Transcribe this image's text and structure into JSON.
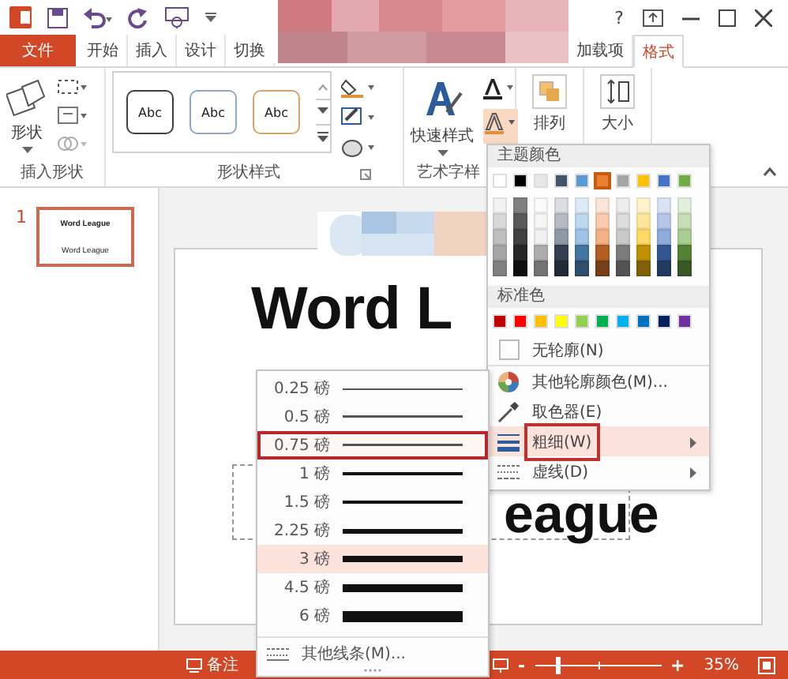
{
  "window": {
    "help": "?"
  },
  "tabs": [
    {
      "label": "文件",
      "kind": "file",
      "selected": false
    },
    {
      "label": "开始",
      "kind": "tab",
      "selected": false
    },
    {
      "label": "插入",
      "kind": "tab",
      "selected": false
    },
    {
      "label": "设计",
      "kind": "tab",
      "selected": false
    },
    {
      "label": "切换",
      "kind": "tab",
      "selected": false
    },
    {
      "label": "加载项",
      "kind": "tab",
      "selected": false
    },
    {
      "label": "格式",
      "kind": "tab",
      "selected": true
    }
  ],
  "ribbon": {
    "insert_shapes": {
      "label": "插入形状",
      "button": "形状"
    },
    "shape_styles": {
      "label": "形状样式",
      "styles": [
        {
          "text": "Abc",
          "color": "#404040"
        },
        {
          "text": "Abc",
          "color": "#8fa9c4"
        },
        {
          "text": "Abc",
          "color": "#d9a46a"
        }
      ]
    },
    "wordart_styles": {
      "label": "艺术字样",
      "button": "快速样式"
    },
    "arrange": {
      "button": "排列"
    },
    "size": {
      "button": "大小"
    }
  },
  "thumbnails": [
    {
      "number": "1",
      "lines": [
        "Word League",
        "Word League"
      ],
      "selected": true
    }
  ],
  "slide": {
    "title": "Word L",
    "subtitle": "eague"
  },
  "outline_menu": {
    "theme_header": "主题颜色",
    "theme_colors": [
      {
        "color": "#ffffff",
        "selected": false
      },
      {
        "color": "#000000",
        "selected": false
      },
      {
        "color": "#e7e6e6",
        "selected": false
      },
      {
        "color": "#44546a",
        "selected": false
      },
      {
        "color": "#5b9bd5",
        "selected": false
      },
      {
        "color": "#ed7d31",
        "selected": true
      },
      {
        "color": "#a5a5a5",
        "selected": false
      },
      {
        "color": "#ffc000",
        "selected": false
      },
      {
        "color": "#4472c4",
        "selected": false
      },
      {
        "color": "#70ad47",
        "selected": false
      }
    ],
    "standard_header": "标准色",
    "standard_colors": [
      {
        "color": "#c00000"
      },
      {
        "color": "#ff0000"
      },
      {
        "color": "#ffc000"
      },
      {
        "color": "#ffff00"
      },
      {
        "color": "#92d050"
      },
      {
        "color": "#00b050"
      },
      {
        "color": "#00b0f0"
      },
      {
        "color": "#0070c0"
      },
      {
        "color": "#002060"
      },
      {
        "color": "#7030a0"
      }
    ],
    "items": [
      {
        "label": "无轮廓(N)",
        "kind": "none",
        "submenu": false,
        "highlighted": false
      },
      {
        "label": "其他轮廓颜色(M)...",
        "kind": "palette",
        "submenu": false,
        "highlighted": false
      },
      {
        "label": "取色器(E)",
        "kind": "eyedropper",
        "submenu": false,
        "highlighted": false
      },
      {
        "label": "粗细(W)",
        "kind": "weight",
        "submenu": true,
        "highlighted": true
      },
      {
        "label": "虚线(D)",
        "kind": "dashes",
        "submenu": true,
        "highlighted": false
      }
    ]
  },
  "weight_menu": {
    "items": [
      {
        "label": "0.25 磅",
        "selected": false,
        "highlighted": false
      },
      {
        "label": "0.5 磅",
        "selected": false,
        "highlighted": false
      },
      {
        "label": "0.75 磅",
        "selected": true,
        "highlighted": false
      },
      {
        "label": "1 磅",
        "selected": false,
        "highlighted": false
      },
      {
        "label": "1.5 磅",
        "selected": false,
        "highlighted": false
      },
      {
        "label": "2.25 磅",
        "selected": false,
        "highlighted": false
      },
      {
        "label": "3 磅",
        "selected": false,
        "highlighted": true
      },
      {
        "label": "4.5 磅",
        "selected": false,
        "highlighted": false
      },
      {
        "label": "6 磅",
        "selected": false,
        "highlighted": false
      }
    ],
    "footer": "其他线条(M)..."
  },
  "status_bar": {
    "notes": "备注",
    "zoom_out": "-",
    "zoom": {
      "level": 0.17
    },
    "zoom_in": "+",
    "zoom_text": "35%"
  }
}
